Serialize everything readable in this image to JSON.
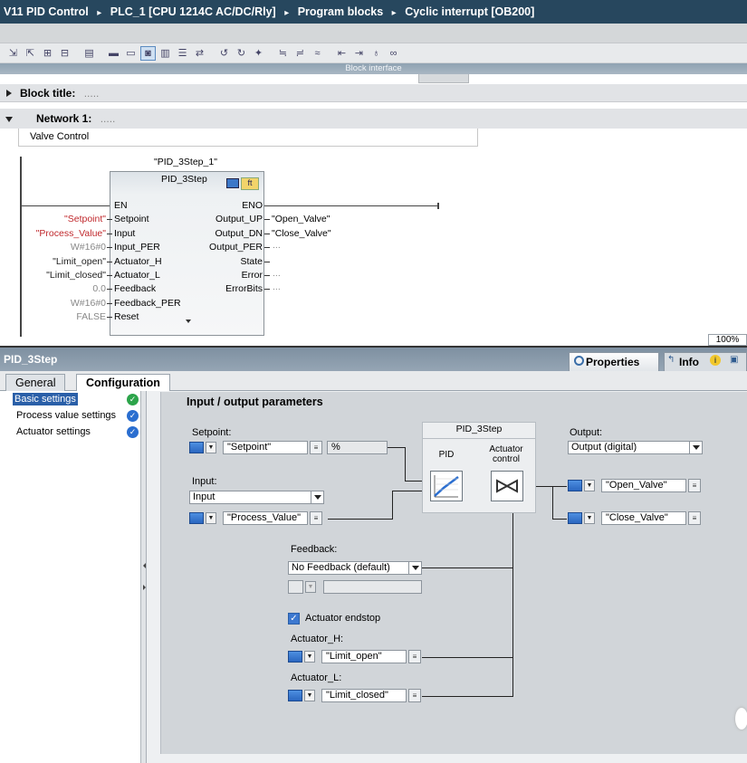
{
  "titlebar": {
    "project": "V11 PID Control",
    "crumbs": [
      "PLC_1 [CPU 1214C AC/DC/Rly]",
      "Program blocks",
      "Cyclic interrupt [OB200]"
    ],
    "separator": "▸"
  },
  "editor": {
    "block_interface_label": "Block interface",
    "block_title_label": "Block title:",
    "block_title_value": ".....",
    "network_label": "Network 1:",
    "network_title_value": ".....",
    "network_comment": "Valve Control",
    "zoom": "100%",
    "fb": {
      "instance": "\"PID_3Step_1\"",
      "type": "PID_3Step",
      "inputs": [
        "EN",
        "Setpoint",
        "Input",
        "Input_PER",
        "Actuator_H",
        "Actuator_L",
        "Feedback",
        "Feedback_PER",
        "Reset"
      ],
      "outputs": [
        "ENO",
        "Output_UP",
        "Output_DN",
        "Output_PER",
        "State",
        "Error",
        "ErrorBits"
      ],
      "input_actuals": [
        "\"Setpoint\"",
        "\"Process_Value\"",
        "W#16#0",
        "\"Limit_open\"",
        "\"Limit_closed\"",
        "0.0",
        "W#16#0",
        "FALSE"
      ],
      "output_actuals": [
        "\"Open_Valve\"",
        "\"Close_Valve\"",
        "...",
        "",
        "...",
        "..."
      ]
    }
  },
  "inspector": {
    "object_name": "PID_3Step",
    "right_tabs": {
      "properties": "Properties",
      "info": "Info"
    },
    "tabs": [
      "General",
      "Configuration"
    ],
    "nav": [
      {
        "label": "Basic settings",
        "status": "green"
      },
      {
        "label": "Process value settings",
        "status": "blue"
      },
      {
        "label": "Actuator settings",
        "status": "blue"
      }
    ],
    "panel_title": "Input / output parameters",
    "setpoint_label": "Setpoint:",
    "setpoint_value": "\"Setpoint\"",
    "setpoint_unit": "%",
    "input_label": "Input:",
    "input_select": "Input",
    "input_value": "\"Process_Value\"",
    "pid_block_title": "PID_3Step",
    "pid_label": "PID",
    "actuator_label": "Actuator control",
    "output_label": "Output:",
    "output_select": "Output (digital)",
    "output_up_value": "\"Open_Valve\"",
    "output_dn_value": "\"Close_Valve\"",
    "feedback_label": "Feedback:",
    "feedback_select": "No Feedback (default)",
    "endstop_label": "Actuator endstop",
    "actuator_h_label": "Actuator_H:",
    "actuator_h_value": "\"Limit_open\"",
    "actuator_l_label": "Actuator_L:",
    "actuator_l_value": "\"Limit_closed\""
  }
}
